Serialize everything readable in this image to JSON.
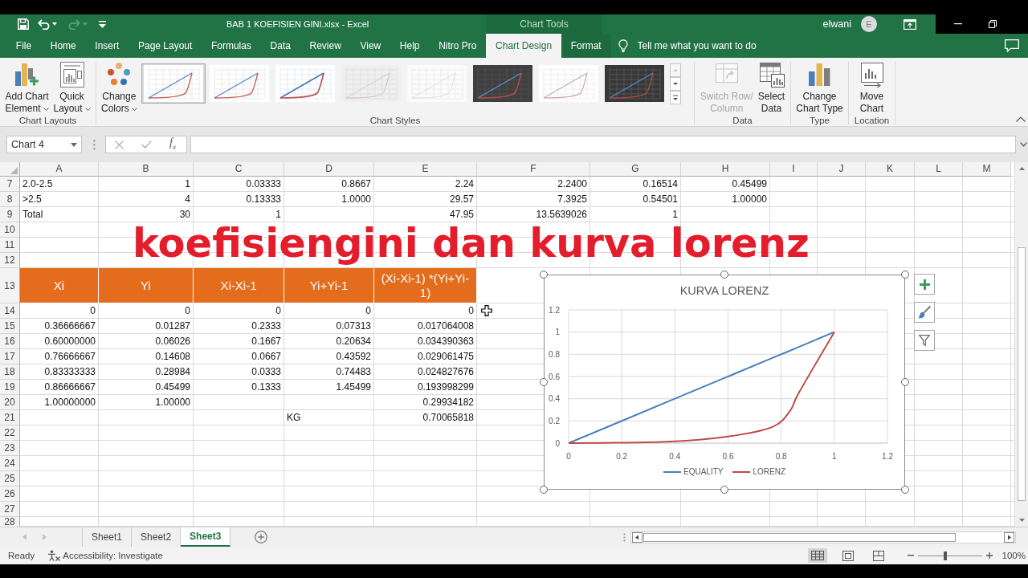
{
  "title_bar": {
    "quick_access": [
      {
        "kind": "save",
        "disabled": false
      },
      {
        "kind": "undo",
        "disabled": false
      },
      {
        "kind": "redo",
        "disabled": true
      },
      {
        "kind": "customize",
        "disabled": false
      }
    ],
    "title": "BAB 1 KOEFISIEN GINI.xlsx - Excel",
    "user": "elwani",
    "avatar_initial": "E"
  },
  "ribbon_tabs": [
    {
      "label": "File",
      "selected": false
    },
    {
      "label": "Home",
      "selected": false
    },
    {
      "label": "Insert",
      "selected": false
    },
    {
      "label": "Page Layout",
      "selected": false
    },
    {
      "label": "Formulas",
      "selected": false
    },
    {
      "label": "Data",
      "selected": false
    },
    {
      "label": "Review",
      "selected": false
    },
    {
      "label": "View",
      "selected": false
    },
    {
      "label": "Help",
      "selected": false
    },
    {
      "label": "Nitro Pro",
      "selected": false
    }
  ],
  "context_tabs": {
    "label": "Chart Tools",
    "tabs": [
      {
        "label": "Chart Design",
        "selected": true
      },
      {
        "label": "Format",
        "selected": false
      }
    ]
  },
  "tell_me": {
    "placeholder": "Tell me what you want to do"
  },
  "ribbon_groups": [
    {
      "label": "Chart Layouts",
      "items": [
        {
          "kind": "add-element",
          "lines": [
            "Add Chart",
            "Element"
          ],
          "dropdown": true,
          "disabled": false
        },
        {
          "kind": "quick-layout",
          "lines": [
            "Quick",
            "Layout"
          ],
          "dropdown": true,
          "disabled": false
        }
      ]
    },
    {
      "label": "Chart Styles",
      "items": [
        {
          "kind": "change-colors",
          "lines": [
            "Change",
            "Colors"
          ],
          "dropdown": true,
          "disabled": false
        },
        {
          "kind": "gallery",
          "scroll_up_disabled": true,
          "styles": [
            {
              "kind": "light",
              "selected": true
            },
            {
              "kind": "light",
              "selected": false
            },
            {
              "kind": "outlined",
              "selected": false
            },
            {
              "kind": "shaded",
              "selected": false
            },
            {
              "kind": "faint",
              "selected": false
            },
            {
              "kind": "dark",
              "selected": false
            },
            {
              "kind": "muted",
              "selected": false
            },
            {
              "kind": "dark-grid",
              "selected": false
            }
          ]
        }
      ]
    },
    {
      "label": "Data",
      "items": [
        {
          "kind": "switch-row-column",
          "lines": [
            "Switch Row/",
            "Column"
          ],
          "dropdown": false,
          "disabled": true
        },
        {
          "kind": "select-data",
          "lines": [
            "Select",
            "Data"
          ],
          "dropdown": false,
          "disabled": false
        }
      ]
    },
    {
      "label": "Type",
      "items": [
        {
          "kind": "change-chart-type",
          "lines": [
            "Change",
            "Chart Type"
          ],
          "dropdown": false,
          "disabled": false
        }
      ]
    },
    {
      "label": "Location",
      "items": [
        {
          "kind": "move-chart",
          "lines": [
            "Move",
            "Chart"
          ],
          "dropdown": false,
          "disabled": false
        }
      ]
    }
  ],
  "formula_bar": {
    "name_box": "Chart 4",
    "buttons": [
      {
        "kind": "cancel",
        "disabled": true
      },
      {
        "kind": "enter",
        "disabled": true
      }
    ],
    "function_label": "f$_{x}$"
  },
  "sheet": {
    "columns": [
      "A",
      "B",
      "C",
      "D",
      "E",
      "F",
      "G",
      "H",
      "I",
      "J",
      "K",
      "L",
      "M"
    ],
    "rows": [
      {
        "number": "7",
        "kind": "data",
        "cells": [
          {
            "kind": "text",
            "value": "2.0-2.5"
          },
          {
            "kind": "number",
            "value": "1"
          },
          {
            "kind": "number",
            "value": "0.03333"
          },
          {
            "kind": "number",
            "value": "0.8667"
          },
          {
            "kind": "number",
            "value": "2.24"
          },
          {
            "kind": "number",
            "value": "2.2400"
          },
          {
            "kind": "number",
            "value": "0.16514"
          },
          {
            "kind": "number",
            "value": "0.45499"
          }
        ]
      },
      {
        "number": "8",
        "kind": "data",
        "cells": [
          {
            "kind": "text",
            "value": ">2.5"
          },
          {
            "kind": "number",
            "value": "4"
          },
          {
            "kind": "number",
            "value": "0.13333"
          },
          {
            "kind": "number",
            "value": "1.0000"
          },
          {
            "kind": "number",
            "value": "29.57"
          },
          {
            "kind": "number",
            "value": "7.3925"
          },
          {
            "kind": "number",
            "value": "0.54501"
          },
          {
            "kind": "number",
            "value": "1.00000"
          }
        ]
      },
      {
        "number": "9",
        "kind": "data",
        "cells": [
          {
            "kind": "text",
            "value": "Total"
          },
          {
            "kind": "number",
            "value": "30"
          },
          {
            "kind": "number",
            "value": "1"
          },
          {
            "kind": "empty"
          },
          {
            "kind": "number",
            "value": "47.95"
          },
          {
            "kind": "number",
            "value": "13.5639026"
          },
          {
            "kind": "number",
            "value": "1"
          }
        ]
      },
      {
        "number": "10",
        "kind": "data"
      },
      {
        "number": "11",
        "kind": "data"
      },
      {
        "number": "12",
        "kind": "data"
      },
      {
        "number": "13",
        "kind": "header",
        "cells": [
          {
            "kind": "header",
            "value": "Xi"
          },
          {
            "kind": "header",
            "value": "Yi"
          },
          {
            "kind": "header",
            "value": "Xi-Xi-1"
          },
          {
            "kind": "header",
            "value": "Yi+Yi-1"
          },
          {
            "kind": "header",
            "value": "(Xi-Xi-1) *(Yi+Yi-1)"
          }
        ]
      },
      {
        "number": "14",
        "kind": "data",
        "cells": [
          {
            "kind": "number",
            "value": "0"
          },
          {
            "kind": "number",
            "value": "0"
          },
          {
            "kind": "number",
            "value": "0"
          },
          {
            "kind": "number",
            "value": "0"
          },
          {
            "kind": "number",
            "value": "0"
          }
        ]
      },
      {
        "number": "15",
        "kind": "data",
        "cells": [
          {
            "kind": "number",
            "value": "0.36666667"
          },
          {
            "kind": "number",
            "value": "0.01287"
          },
          {
            "kind": "number",
            "value": "0.2333"
          },
          {
            "kind": "number",
            "value": "0.07313"
          },
          {
            "kind": "number",
            "value": "0.017064008"
          }
        ]
      },
      {
        "number": "16",
        "kind": "data",
        "cells": [
          {
            "kind": "number",
            "value": "0.60000000"
          },
          {
            "kind": "number",
            "value": "0.06026"
          },
          {
            "kind": "number",
            "value": "0.1667"
          },
          {
            "kind": "number",
            "value": "0.20634"
          },
          {
            "kind": "number",
            "value": "0.034390363"
          }
        ]
      },
      {
        "number": "17",
        "kind": "data",
        "cells": [
          {
            "kind": "number",
            "value": "0.76666667"
          },
          {
            "kind": "number",
            "value": "0.14608"
          },
          {
            "kind": "number",
            "value": "0.0667"
          },
          {
            "kind": "number",
            "value": "0.43592"
          },
          {
            "kind": "number",
            "value": "0.029061475"
          }
        ]
      },
      {
        "number": "18",
        "kind": "data",
        "cells": [
          {
            "kind": "number",
            "value": "0.83333333"
          },
          {
            "kind": "number",
            "value": "0.28984"
          },
          {
            "kind": "number",
            "value": "0.0333"
          },
          {
            "kind": "number",
            "value": "0.74483"
          },
          {
            "kind": "number",
            "value": "0.024827676"
          }
        ]
      },
      {
        "number": "19",
        "kind": "data",
        "cells": [
          {
            "kind": "number",
            "value": "0.86666667"
          },
          {
            "kind": "number",
            "value": "0.45499"
          },
          {
            "kind": "number",
            "value": "0.1333"
          },
          {
            "kind": "number",
            "value": "1.45499"
          },
          {
            "kind": "number",
            "value": "0.193998299"
          }
        ]
      },
      {
        "number": "20",
        "kind": "data",
        "cells": [
          {
            "kind": "number",
            "value": "1.00000000"
          },
          {
            "kind": "number",
            "value": "1.00000"
          },
          {
            "kind": "empty"
          },
          {
            "kind": "empty"
          },
          {
            "kind": "number",
            "value": "0.29934182"
          }
        ]
      },
      {
        "number": "21",
        "kind": "data",
        "cells": [
          {
            "kind": "empty"
          },
          {
            "kind": "empty"
          },
          {
            "kind": "empty"
          },
          {
            "kind": "text",
            "value": "KG"
          },
          {
            "kind": "number",
            "value": "0.70065818"
          }
        ]
      },
      {
        "number": "22",
        "kind": "data"
      },
      {
        "number": "23",
        "kind": "data"
      },
      {
        "number": "24",
        "kind": "data"
      },
      {
        "number": "25",
        "kind": "data"
      },
      {
        "number": "26",
        "kind": "data"
      },
      {
        "number": "27",
        "kind": "data"
      },
      {
        "number": "28",
        "kind": "data"
      }
    ]
  },
  "video_caption": "koefisiengini dan kurva lorenz",
  "chart": {
    "selected": true,
    "chart_data": {
      "type": "line",
      "title": "KURVA LORENZ",
      "x": [
        0,
        0.367,
        0.6,
        0.767,
        0.833,
        0.867,
        1
      ],
      "series": [
        {
          "name": "EQUALITY",
          "color": "#4a7ebb",
          "values": [
            0,
            0.367,
            0.6,
            0.767,
            0.833,
            0.867,
            1
          ]
        },
        {
          "name": "LORENZ",
          "color": "#be4b48",
          "values": [
            0,
            0.013,
            0.06,
            0.146,
            0.29,
            0.455,
            1
          ]
        }
      ],
      "xlim": [
        0,
        1.2
      ],
      "ylim": [
        0,
        1.2
      ],
      "xticks": [
        0,
        0.2,
        0.4,
        0.6,
        0.8,
        1,
        1.2
      ],
      "yticks": [
        0,
        0.2,
        0.4,
        0.6,
        0.8,
        1,
        1.2
      ],
      "grid": true,
      "legend": "bottom"
    }
  },
  "sheet_tabs": {
    "nav_disabled": true,
    "tabs": [
      {
        "label": "Sheet1",
        "selected": false
      },
      {
        "label": "Sheet2",
        "selected": false
      },
      {
        "label": "Sheet3",
        "selected": true
      }
    ]
  },
  "status_bar": {
    "mode": "Ready",
    "accessibility": "Accessibility: Investigate",
    "views": [
      {
        "kind": "normal",
        "selected": true
      },
      {
        "kind": "page-layout",
        "selected": false
      },
      {
        "kind": "page-break",
        "selected": false
      }
    ],
    "zoom": {
      "level": 0.43,
      "reading": "100%"
    }
  }
}
